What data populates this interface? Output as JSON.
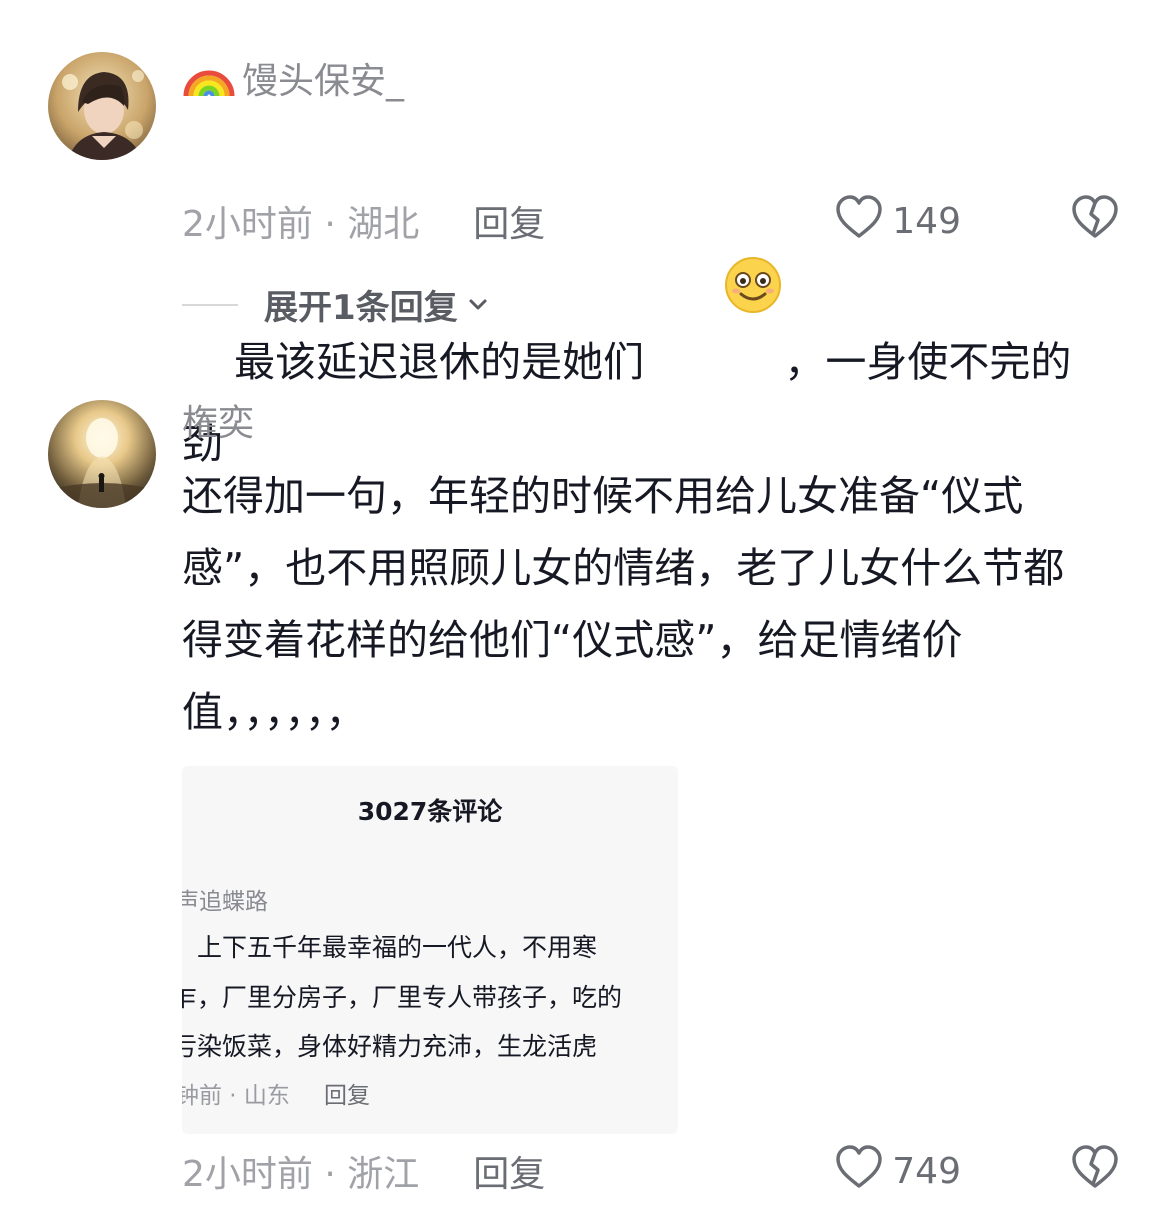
{
  "comments": [
    {
      "username": "馒头保安_",
      "username_prefix_icon": "rainbow-icon",
      "text_before_emoji": "最该延迟退休的是她们",
      "emoji": "smiley-emoji-icon",
      "text_after_emoji": "，一身使不完的劲",
      "time_location": "2小时前 · 湖北",
      "reply_label": "回复",
      "like_count": "149",
      "expand_replies": "展开1条回复"
    },
    {
      "username": "権奕",
      "text": "还得加一句，年轻的时候不用给儿女准备“仪式感”，也不用照顾儿女的情绪，老了儿女什么节都得变着花样的给他们“仪式感”，给足情绪价值，，，，，，",
      "time_location": "2小时前 · 浙江",
      "reply_label": "回复",
      "like_count": "749",
      "embedded_screenshot": {
        "title": "3027条评论",
        "username": "声追蝶路",
        "lines": [
          "，上下五千年最幸福的一代人，不用寒",
          "乍，厂里分房子，厂里专人带孩子，吃的",
          "亏染饭菜，身体好精力充沛，生龙活虎"
        ],
        "time_location": "钟前 · 山东",
        "reply_label": "回复"
      }
    }
  ],
  "colors": {
    "text_primary": "#161823",
    "text_secondary": "#8a8b91",
    "icon": "#6b6d74"
  }
}
